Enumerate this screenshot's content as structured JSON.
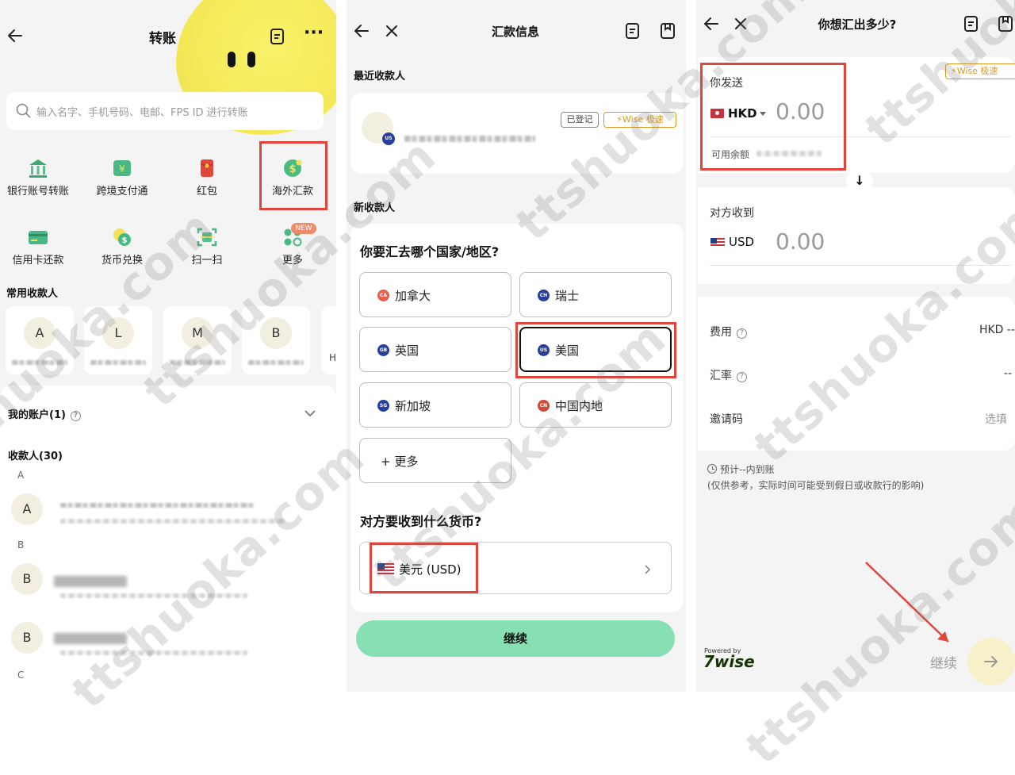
{
  "panel1": {
    "title": "转账",
    "search_placeholder": "输入名字、手机号码、电邮、FPS ID 进行转账",
    "services": [
      {
        "label": "银行账号转账",
        "icon": "bank-icon"
      },
      {
        "label": "跨境支付通",
        "icon": "yuan-card-icon"
      },
      {
        "label": "红包",
        "icon": "red-packet-icon"
      },
      {
        "label": "海外汇款",
        "icon": "overseas-remit-icon"
      },
      {
        "label": "信用卡还款",
        "icon": "credit-card-icon"
      },
      {
        "label": "货币兑换",
        "icon": "currency-exchange-icon"
      },
      {
        "label": "扫一扫",
        "icon": "scan-icon"
      },
      {
        "label": "更多",
        "icon": "more-grid-icon"
      }
    ],
    "new_badge": "NEW",
    "frequent_title": "常用收款人",
    "frequent": [
      "A",
      "L",
      "M",
      "B",
      "H"
    ],
    "my_accounts": "我的账户(1)",
    "payees_title": "收款人(30)",
    "groups": [
      "A",
      "B",
      "C"
    ],
    "payee_avatars": [
      "A",
      "B",
      "B"
    ]
  },
  "panel2": {
    "title": "汇款信息",
    "recent_title": "最近收款人",
    "registered_badge": "已登记",
    "wise_badge": "Wise 极速",
    "recent_flag": "US",
    "new_title": "新收款人",
    "country_question": "你要汇去哪个国家/地区?",
    "countries": [
      {
        "code": "CA",
        "name": "加拿大",
        "color": "#e8604c"
      },
      {
        "code": "CH",
        "name": "瑞士",
        "color": "#2a3e9c"
      },
      {
        "code": "GB",
        "name": "英国",
        "color": "#2a3e9c"
      },
      {
        "code": "US",
        "name": "美国",
        "color": "#2a3e9c"
      },
      {
        "code": "SG",
        "name": "新加坡",
        "color": "#2a3e9c"
      },
      {
        "code": "CN",
        "name": "中国内地",
        "color": "#d04a3a"
      }
    ],
    "more_countries": "+ 更多",
    "currency_question": "对方要收到什么货币?",
    "currency_selected": "美元 (USD)",
    "continue_label": "继续"
  },
  "panel3": {
    "title": "你想汇出多少?",
    "wise_badge": "Wise 极速",
    "send_label": "你发送",
    "send_currency": "HKD",
    "send_amount": "0.00",
    "balance_label": "可用余额",
    "receive_label": "对方收到",
    "receive_currency": "USD",
    "receive_amount": "0.00",
    "fee_label": "费用",
    "fee_value": "HKD --",
    "rate_label": "汇率",
    "rate_value": "--",
    "invite_label": "邀请码",
    "invite_value": "选填",
    "eta_line1": "预计--内到账",
    "eta_line2": "(仅供参考，实际时间可能受到假日或收款行的影响)",
    "powered_by": "Powered by",
    "wise_logo": "7wise",
    "continue_label": "继续"
  },
  "watermark": "ttshuoka.com",
  "colors": {
    "highlight": "#e2453c",
    "continue_green": "#86e0b4",
    "wise_gold": "#d89a1e",
    "yellow": "#f6ec5a"
  }
}
